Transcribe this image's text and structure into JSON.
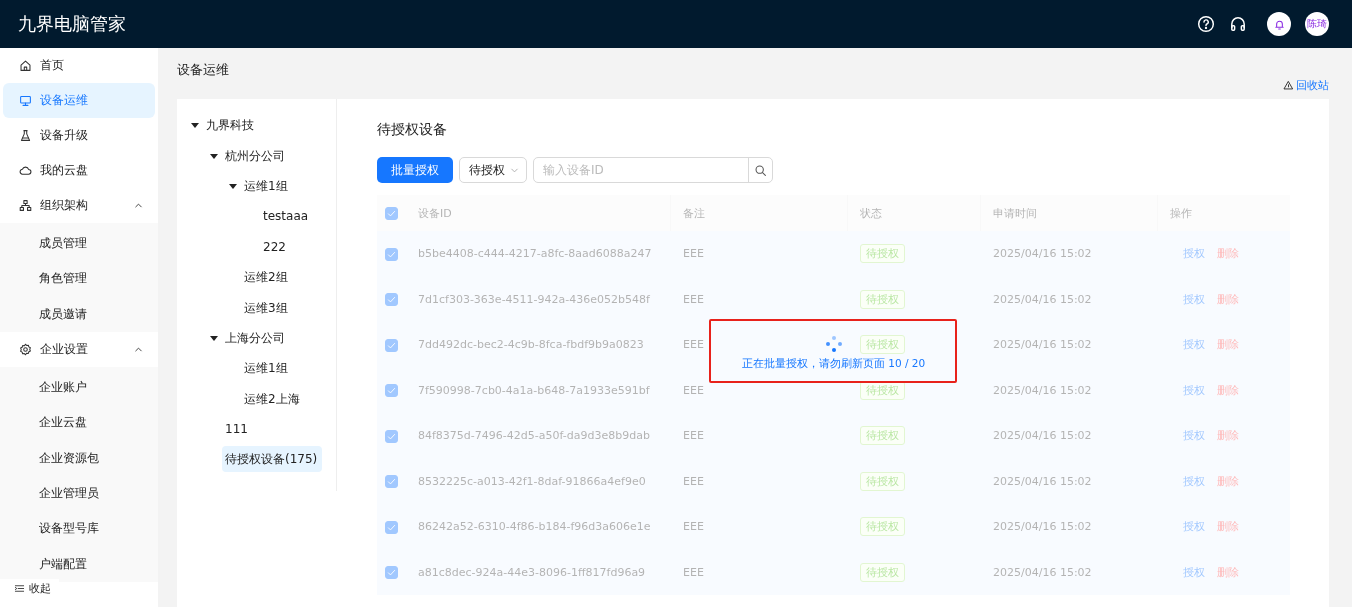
{
  "app": {
    "title": "九界电脑管家",
    "avatar": "陈琦"
  },
  "sidebar": {
    "items": [
      {
        "label": "首页",
        "selected": false
      },
      {
        "label": "设备运维",
        "selected": true
      },
      {
        "label": "设备升级",
        "selected": false
      },
      {
        "label": "我的云盘",
        "selected": false
      },
      {
        "label": "组织架构",
        "selected": false,
        "expanded": true,
        "children": [
          {
            "label": "成员管理",
            "selected": false
          },
          {
            "label": "角色管理",
            "selected": false
          },
          {
            "label": "成员邀请",
            "selected": false
          }
        ]
      },
      {
        "label": "企业设置",
        "selected": false,
        "expanded": true,
        "children": [
          {
            "label": "企业账户",
            "selected": false
          },
          {
            "label": "企业云盘",
            "selected": false
          },
          {
            "label": "企业资源包",
            "selected": false
          },
          {
            "label": "企业管理员",
            "selected": false
          },
          {
            "label": "设备型号库",
            "selected": false
          },
          {
            "label": "户端配置",
            "selected": false
          }
        ]
      }
    ],
    "collapse": "收起"
  },
  "page": {
    "title": "设备运维",
    "recycle_link": "回收站"
  },
  "tree": [
    {
      "label": "九界科技",
      "selected": false,
      "expanded": true,
      "children": [
        {
          "label": "杭州分公司",
          "selected": false,
          "expanded": true,
          "children": [
            {
              "label": "运维1组",
              "selected": false,
              "expanded": true,
              "children": [
                {
                  "label": "testaaa",
                  "selected": false
                },
                {
                  "label": "222",
                  "selected": false
                }
              ]
            },
            {
              "label": "运维2组",
              "selected": false
            },
            {
              "label": "运维3组",
              "selected": false
            }
          ]
        },
        {
          "label": "上海分公司",
          "selected": false,
          "expanded": true,
          "children": [
            {
              "label": "运维1组",
              "selected": false
            },
            {
              "label": "运维2上海",
              "selected": false
            }
          ]
        },
        {
          "label": "111",
          "selected": false
        },
        {
          "label": "待授权设备(175)",
          "selected": true
        }
      ]
    }
  ],
  "list": {
    "title": "待授权设备",
    "batch_button": "批量授权",
    "filter": "待授权",
    "search": {
      "placeholder": "输入设备ID"
    },
    "loading": {
      "on": true,
      "message": "正在批量授权，请勿刷新页面 10 / 20"
    },
    "table": {
      "all_checked": true,
      "columns": [
        "设备ID",
        "备注",
        "状态",
        "申请时间",
        "操作"
      ],
      "rows": [
        {
          "checked": true,
          "id": "b5be4408-c444-4217-a8fc-8aad6088a247",
          "note": "EEE",
          "status": "待授权",
          "time": "2025/04/16 15:02",
          "actions": [
            "授权",
            "删除"
          ]
        },
        {
          "checked": true,
          "id": "7d1cf303-363e-4511-942a-436e052b548f",
          "note": "EEE",
          "status": "待授权",
          "time": "2025/04/16 15:02",
          "actions": [
            "授权",
            "删除"
          ]
        },
        {
          "checked": true,
          "id": "7dd492dc-bec2-4c9b-8fca-fbdf9b9a0823",
          "note": "EEE",
          "status": "待授权",
          "time": "2025/04/16 15:02",
          "actions": [
            "授权",
            "删除"
          ]
        },
        {
          "checked": true,
          "id": "7f590998-7cb0-4a1a-b648-7a1933e591bf",
          "note": "EEE",
          "status": "待授权",
          "time": "2025/04/16 15:02",
          "actions": [
            "授权",
            "删除"
          ]
        },
        {
          "checked": true,
          "id": "84f8375d-7496-42d5-a50f-da9d3e8b9dab",
          "note": "EEE",
          "status": "待授权",
          "time": "2025/04/16 15:02",
          "actions": [
            "授权",
            "删除"
          ]
        },
        {
          "checked": true,
          "id": "8532225c-a013-42f1-8daf-91866a4ef9e0",
          "note": "EEE",
          "status": "待授权",
          "time": "2025/04/16 15:02",
          "actions": [
            "授权",
            "删除"
          ]
        },
        {
          "checked": true,
          "id": "86242a52-6310-4f86-b184-f96d3a606e1e",
          "note": "EEE",
          "status": "待授权",
          "time": "2025/04/16 15:02",
          "actions": [
            "授权",
            "删除"
          ]
        },
        {
          "checked": true,
          "id": "a81c8dec-924a-44e3-8096-1ff817fd96a9",
          "note": "EEE",
          "status": "待授权",
          "time": "2025/04/16 15:02",
          "actions": [
            "授权",
            "删除"
          ]
        }
      ]
    }
  }
}
